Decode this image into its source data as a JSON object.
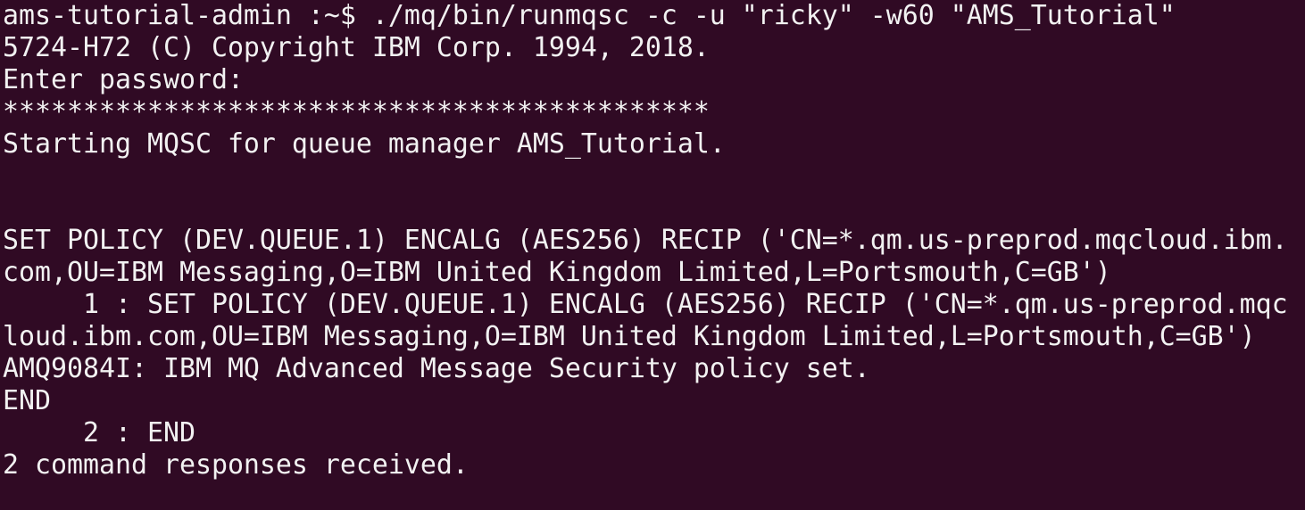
{
  "terminal": {
    "lines": [
      "ams-tutorial-admin :~$ ./mq/bin/runmqsc -c -u \"ricky\" -w60 \"AMS_Tutorial\"",
      "5724-H72 (C) Copyright IBM Corp. 1994, 2018.",
      "Enter password:",
      "********************************************",
      "Starting MQSC for queue manager AMS_Tutorial.",
      "",
      "",
      "SET POLICY (DEV.QUEUE.1) ENCALG (AES256) RECIP ('CN=*.qm.us-preprod.mqcloud.ibm.",
      "com,OU=IBM Messaging,O=IBM United Kingdom Limited,L=Portsmouth,C=GB')",
      "     1 : SET POLICY (DEV.QUEUE.1) ENCALG (AES256) RECIP ('CN=*.qm.us-preprod.mqc",
      "loud.ibm.com,OU=IBM Messaging,O=IBM United Kingdom Limited,L=Portsmouth,C=GB')",
      "AMQ9084I: IBM MQ Advanced Message Security policy set.",
      "END",
      "     2 : END",
      "2 command responses received."
    ]
  },
  "colors": {
    "background": "#300a24",
    "text": "#f2f2f2"
  }
}
